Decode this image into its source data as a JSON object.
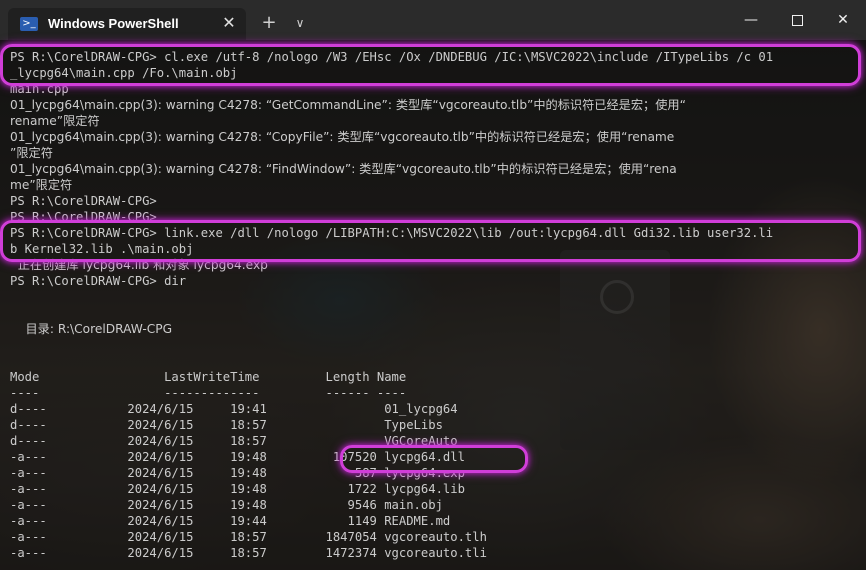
{
  "window": {
    "tab_title": "Windows PowerShell",
    "tab_icon": "powershell-icon",
    "close_tab_glyph": "✕",
    "new_tab_glyph": "+",
    "dropdown_glyph": "∨",
    "minimize_glyph": "—",
    "close_glyph": "✕"
  },
  "terminal": {
    "lines": [
      "PS R:\\CorelDRAW-CPG> cl.exe /utf-8 /nologo /W3 /EHsc /Ox /DNDEBUG /IC:\\MSVC2022\\include /ITypeLibs /c 01",
      "_lycpg64\\main.cpp /Fo.\\main.obj",
      "main.cpp",
      "01_lycpg64\\main.cpp(3): warning C4278: “GetCommandLine”: 类型库“vgcoreauto.tlb”中的标识符已经是宏；使用“",
      "rename”限定符",
      "01_lycpg64\\main.cpp(3): warning C4278: “CopyFile”: 类型库“vgcoreauto.tlb”中的标识符已经是宏；使用“rename",
      "”限定符",
      "01_lycpg64\\main.cpp(3): warning C4278: “FindWindow”: 类型库“vgcoreauto.tlb”中的标识符已经是宏；使用“rena",
      "me”限定符",
      "PS R:\\CorelDRAW-CPG>",
      "PS R:\\CorelDRAW-CPG>",
      "PS R:\\CorelDRAW-CPG> link.exe /dll /nologo /LIBPATH:C:\\MSVC2022\\lib /out:lycpg64.dll Gdi32.lib user32.li",
      "b Kernel32.lib .\\main.obj",
      "  正在创建库 lycpg64.lib 和对象 lycpg64.exp",
      "PS R:\\CorelDRAW-CPG> dir",
      "",
      "",
      "    目录: R:\\CorelDRAW-CPG",
      "",
      "",
      "Mode                 LastWriteTime         Length Name",
      "----                 -------------         ------ ----",
      "d----           2024/6/15     19:41                01_lycpg64",
      "d----           2024/6/15     18:57                TypeLibs",
      "d----           2024/6/15     18:57                VGCoreAuto",
      "-a---           2024/6/15     19:48         107520 lycpg64.dll",
      "-a---           2024/6/15     19:48            587 lycpg64.exp",
      "-a---           2024/6/15     19:48           1722 lycpg64.lib",
      "-a---           2024/6/15     19:48           9546 main.obj",
      "-a---           2024/6/15     19:44           1149 README.md",
      "-a---           2024/6/15     18:57        1847054 vgcoreauto.tlh",
      "-a---           2024/6/15     18:57        1472374 vgcoreauto.tli"
    ]
  },
  "highlight_color": "#d03ed8"
}
